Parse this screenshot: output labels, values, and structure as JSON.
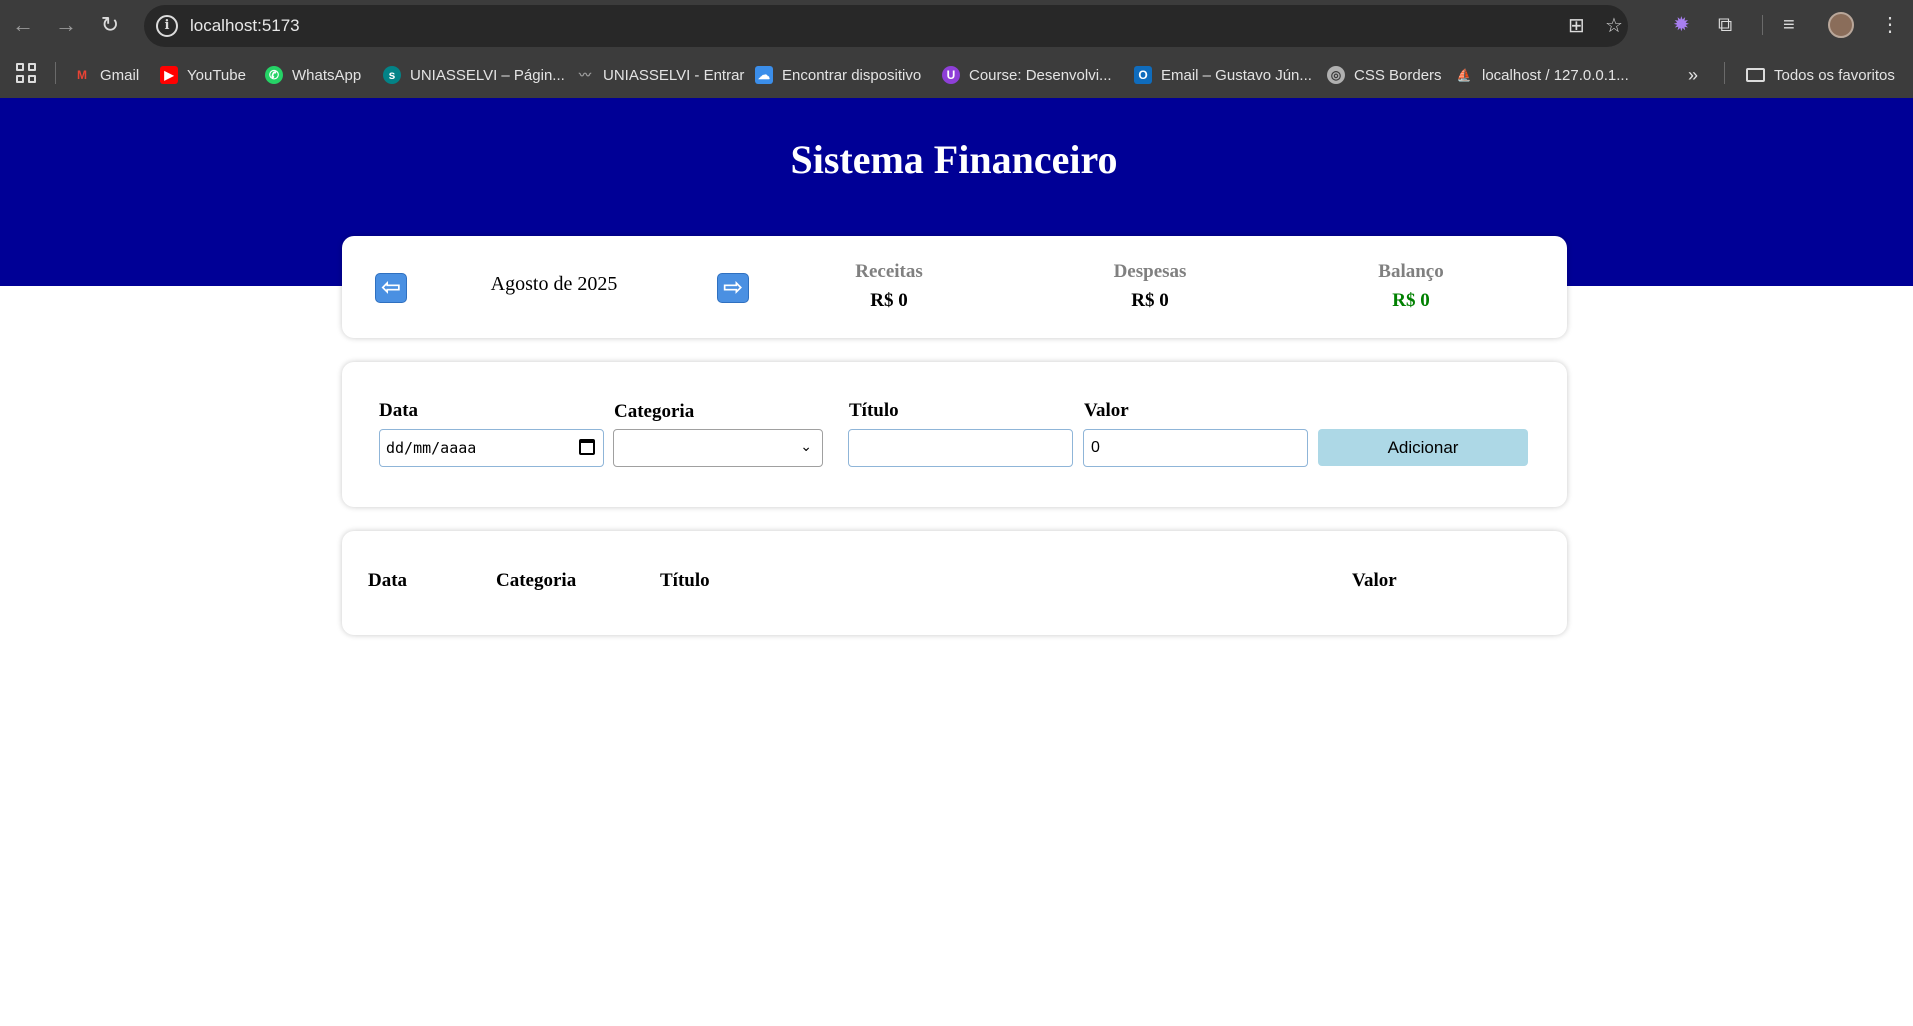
{
  "browser": {
    "url": "localhost:5173",
    "bookmarks": [
      {
        "label": "Gmail",
        "icon": "gmail-icon"
      },
      {
        "label": "YouTube",
        "icon": "youtube-icon"
      },
      {
        "label": "WhatsApp",
        "icon": "whatsapp-icon"
      },
      {
        "label": "UNIASSELVI – Págin...",
        "icon": "sharepoint-icon"
      },
      {
        "label": "UNIASSELVI - Entrar",
        "icon": "uniasselvi-icon"
      },
      {
        "label": "Encontrar dispositivo",
        "icon": "cloud-icon"
      },
      {
        "label": "Course: Desenvolvi...",
        "icon": "course-icon"
      },
      {
        "label": "Email – Gustavo Jún...",
        "icon": "outlook-icon"
      },
      {
        "label": "CSS Borders",
        "icon": "globe-icon"
      },
      {
        "label": "localhost / 127.0.0.1...",
        "icon": "phpmyadmin-icon"
      }
    ],
    "all_bookmarks_label": "Todos os favoritos"
  },
  "app": {
    "title": "Sistema Financeiro",
    "month_label": "Agosto de 2025",
    "summary": {
      "receitas_label": "Receitas",
      "receitas_value": "R$ 0",
      "despesas_label": "Despesas",
      "despesas_value": "R$ 0",
      "balanco_label": "Balanço",
      "balanco_value": "R$ 0",
      "balanco_color": "#008000"
    },
    "form": {
      "data_label": "Data",
      "date_placeholder": "dd/mm/aaaa",
      "categoria_label": "Categoria",
      "categoria_selected": "",
      "titulo_label": "Título",
      "titulo_value": "",
      "valor_label": "Valor",
      "valor_value": "0",
      "add_button": "Adicionar"
    },
    "table": {
      "headers": [
        "Data",
        "Categoria",
        "Título",
        "Valor"
      ],
      "rows": []
    }
  },
  "colors": {
    "header_bg": "#000096",
    "add_button_bg": "#add8e6",
    "arrow_button_bg": "#4a90e2"
  }
}
